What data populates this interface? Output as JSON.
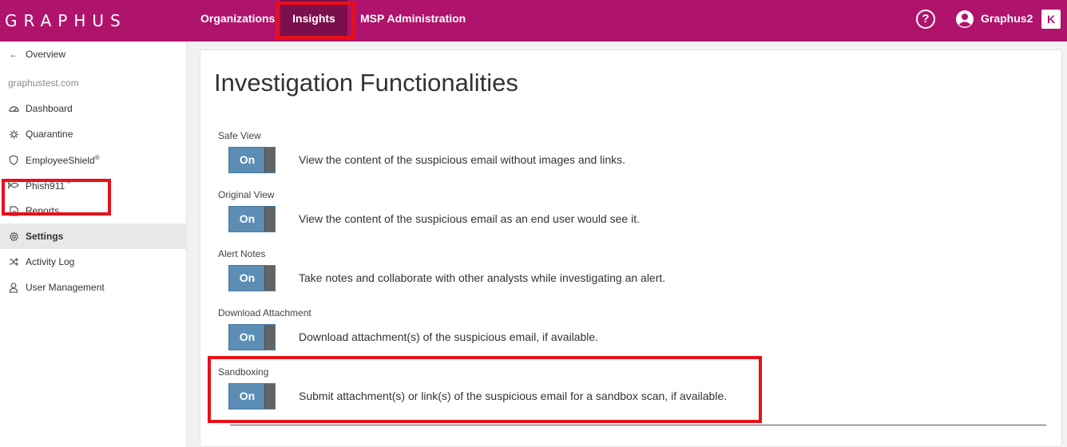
{
  "brand": {
    "logo_text": "GRAPHUS",
    "accent": "#b0136b",
    "highlight": "#e8101a"
  },
  "nav": {
    "organizations": "Organizations",
    "insights": "Insights",
    "msp_admin": "MSP Administration"
  },
  "header": {
    "user_name": "Graphus2",
    "help": "?",
    "k_logo": "K"
  },
  "sidebar": {
    "back_label": "Overview",
    "domain": "graphustest.com",
    "items": [
      {
        "label": "Dashboard",
        "icon": "dashboard-icon"
      },
      {
        "label": "Quarantine",
        "icon": "quarantine-icon"
      },
      {
        "label": "EmployeeShield",
        "sup": "®",
        "icon": "shield-icon"
      },
      {
        "label": "Phish911",
        "sup": "™",
        "icon": "fish-icon"
      },
      {
        "label": "Reports",
        "icon": "report-icon"
      },
      {
        "label": "Settings",
        "icon": "gear-icon",
        "active": true
      },
      {
        "label": "Activity Log",
        "icon": "shuffle-icon"
      },
      {
        "label": "User Management",
        "icon": "user-icon"
      }
    ]
  },
  "main": {
    "title": "Investigation Functionalities",
    "features": [
      {
        "label": "Safe View",
        "toggle": "On",
        "desc": "View the content of the suspicious email without images and links."
      },
      {
        "label": "Original View",
        "toggle": "On",
        "desc": "View the content of the suspicious email as an end user would see it."
      },
      {
        "label": "Alert Notes",
        "toggle": "On",
        "desc": "Take notes and collaborate with other analysts while investigating an alert."
      },
      {
        "label": "Download Attachment",
        "toggle": "On",
        "desc": "Download attachment(s) of the suspicious email, if available."
      },
      {
        "label": "Sandboxing",
        "toggle": "On",
        "desc": "Submit attachment(s) or link(s) of the suspicious email for a sandbox scan, if available."
      }
    ]
  }
}
